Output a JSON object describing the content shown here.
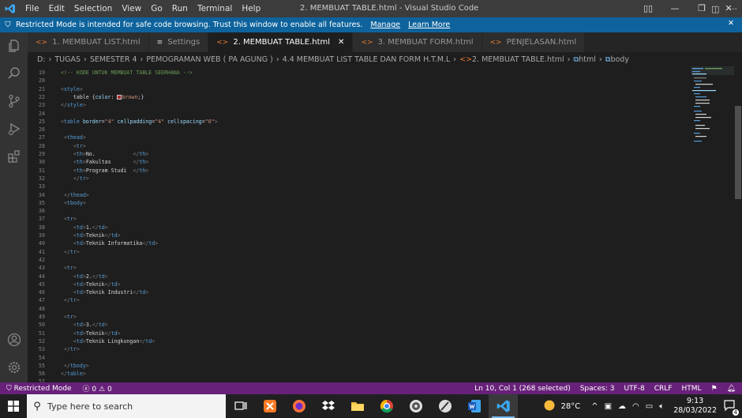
{
  "titlebar": {
    "menu": [
      "File",
      "Edit",
      "Selection",
      "View",
      "Go",
      "Run",
      "Terminal",
      "Help"
    ],
    "title": "2. MEMBUAT TABLE.html - Visual Studio Code"
  },
  "banner": {
    "message": "Restricted Mode is intended for safe code browsing. Trust this window to enable all features.",
    "manage": "Manage",
    "learn_more": "Learn More"
  },
  "tabs": [
    {
      "label": "1. MEMBUAT LIST.html",
      "icon": "<>",
      "active": false
    },
    {
      "label": "Settings",
      "icon": "≡",
      "active": false
    },
    {
      "label": "2. MEMBUAT TABLE.html",
      "icon": "<>",
      "active": true
    },
    {
      "label": "3. MEMBUAT FORM.html",
      "icon": "<>",
      "active": false
    },
    {
      "label": "PENJELASAN.html",
      "icon": "<>",
      "active": false
    }
  ],
  "breadcrumb": {
    "parts": [
      "D:",
      "TUGAS",
      "SEMESTER 4",
      "PEMOGRAMAN WEB ( PA AGUNG )",
      "4.4 MEMBUAT LIST TABLE DAN FORM H.T.M.L",
      "2. MEMBUAT TABLE.html",
      "html",
      "body"
    ]
  },
  "editor": {
    "lines": [
      {
        "n": "19",
        "code": "<!-- KODE UNTUK MEMBUAT TABLE SEERHANA -->"
      },
      {
        "n": "20",
        "code": ""
      },
      {
        "n": "21",
        "code": "<style>"
      },
      {
        "n": "22",
        "code": "    table {color: ■brown;}"
      },
      {
        "n": "23",
        "code": "</style>"
      },
      {
        "n": "24",
        "code": ""
      },
      {
        "n": "25",
        "code": "<table border=\"4\" cellpadding=\"4\" cellspacing=\"0\">"
      },
      {
        "n": "26",
        "code": ""
      },
      {
        "n": "27",
        "code": " <thead>"
      },
      {
        "n": "28",
        "code": "    <tr>"
      },
      {
        "n": "29",
        "code": "    <th>No.            </th>"
      },
      {
        "n": "30",
        "code": "    <th>Fakultas       </th>"
      },
      {
        "n": "31",
        "code": "    <th>Program Studi  </th>"
      },
      {
        "n": "32",
        "code": "    </tr>"
      },
      {
        "n": "33",
        "code": ""
      },
      {
        "n": "34",
        "code": " </thead>"
      },
      {
        "n": "35",
        "code": " <tbody>"
      },
      {
        "n": "36",
        "code": ""
      },
      {
        "n": "37",
        "code": " <tr>"
      },
      {
        "n": "38",
        "code": "    <td>1.</td>"
      },
      {
        "n": "39",
        "code": "    <td>Teknik</td>"
      },
      {
        "n": "40",
        "code": "    <td>Teknik Informatika</td>"
      },
      {
        "n": "41",
        "code": " </tr>"
      },
      {
        "n": "42",
        "code": ""
      },
      {
        "n": "43",
        "code": " <tr>"
      },
      {
        "n": "44",
        "code": "    <td>2.</td>"
      },
      {
        "n": "45",
        "code": "    <td>Teknik</td>"
      },
      {
        "n": "46",
        "code": "    <td>Teknik Industri</td>"
      },
      {
        "n": "47",
        "code": " </tr>"
      },
      {
        "n": "48",
        "code": ""
      },
      {
        "n": "49",
        "code": " <tr>"
      },
      {
        "n": "50",
        "code": "    <td>3.</td>"
      },
      {
        "n": "51",
        "code": "    <td>Teknik</td>"
      },
      {
        "n": "52",
        "code": "    <td>Teknik Lingkungan</td>"
      },
      {
        "n": "53",
        "code": " </tr>"
      },
      {
        "n": "54",
        "code": ""
      },
      {
        "n": "55",
        "code": " </tbody>"
      },
      {
        "n": "56",
        "code": "</table>"
      },
      {
        "n": "57",
        "code": ""
      }
    ]
  },
  "statusbar": {
    "mode": "Restricted Mode",
    "problems": "0",
    "warnings": "0",
    "position": "Ln 10, Col 1 (268 selected)",
    "spaces": "Spaces: 3",
    "encoding": "UTF-8",
    "eol": "CRLF",
    "language": "HTML"
  },
  "taskbar": {
    "search_placeholder": "Type here to search",
    "temperature": "28°C",
    "time": "9:13",
    "date": "28/03/2022",
    "notifications": "4"
  },
  "colors": {
    "statusbar": "#68217a",
    "banner": "#0e639c",
    "editor_bg": "#1e1e1e"
  }
}
